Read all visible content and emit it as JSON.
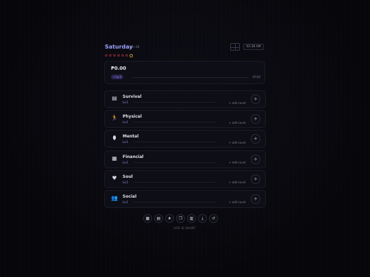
{
  "header": {
    "day": "Saturday",
    "date": "Jun 28",
    "clock": "02:38 AM",
    "streak_dots": 7
  },
  "summary": {
    "balance": "₱0.00",
    "level": "⚡ Lv.1",
    "xp": "0/100"
  },
  "categories": [
    {
      "name": "Survival",
      "icon": "▤",
      "level": "Lv.1",
      "add_label": "+ add count"
    },
    {
      "name": "Physical",
      "icon": "🏃",
      "level": "Lv.1",
      "add_label": "+ add count"
    },
    {
      "name": "Mental",
      "icon": "⬮",
      "level": "Lv.1",
      "add_label": "+ add count"
    },
    {
      "name": "Financial",
      "icon": "▦",
      "level": "Lv.1",
      "add_label": "+ add count"
    },
    {
      "name": "Soul",
      "icon": "♥",
      "level": "Lv.1",
      "add_label": "+ add count"
    },
    {
      "name": "Social",
      "icon": "👥",
      "level": "Lv.1",
      "add_label": "+ add count"
    }
  ],
  "toolbar": [
    {
      "icon": "▦",
      "name": "calendar-icon"
    },
    {
      "icon": "▤",
      "name": "calendar-grid-icon"
    },
    {
      "icon": "★",
      "name": "star-icon"
    },
    {
      "icon": "❐",
      "name": "cards-icon"
    },
    {
      "icon": "▥",
      "name": "report-icon"
    },
    {
      "icon": "⤓",
      "name": "download-icon"
    },
    {
      "icon": "↺",
      "name": "reset-icon"
    }
  ],
  "footer": "LIFE IS SHORT"
}
